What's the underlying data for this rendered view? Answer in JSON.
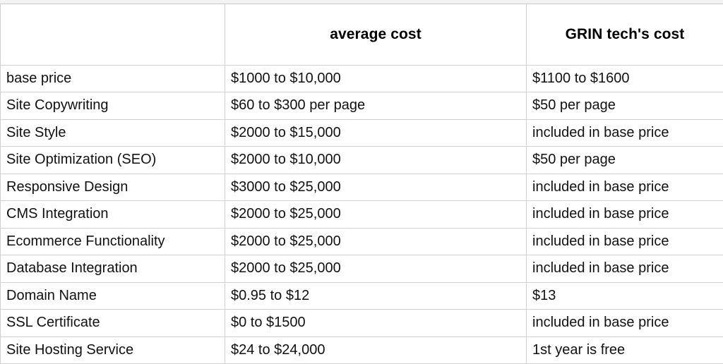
{
  "table": {
    "name": "website-cost-comparison-table",
    "columns": [
      {
        "key": "feature",
        "label": "",
        "align": "left"
      },
      {
        "key": "average",
        "label": "average cost",
        "align": "center"
      },
      {
        "key": "grin",
        "label": "GRIN tech's cost",
        "align": "center"
      }
    ],
    "rows": [
      {
        "feature": "base price",
        "average": "$1000 to $10,000",
        "grin": "$1100 to $1600"
      },
      {
        "feature": "Site Copywriting",
        "average": "$60 to $300 per page",
        "grin": "$50 per page"
      },
      {
        "feature": "Site Style",
        "average": "$2000 to $15,000",
        "grin": "included in base price"
      },
      {
        "feature": "Site Optimization (SEO)",
        "average": "$2000 to $10,000",
        "grin": "$50 per page"
      },
      {
        "feature": "Responsive Design",
        "average": "$3000 to $25,000",
        "grin": "included in base price"
      },
      {
        "feature": "CMS Integration",
        "average": "$2000 to $25,000",
        "grin": "included in base price"
      },
      {
        "feature": "Ecommerce Functionality",
        "average": "$2000 to $25,000",
        "grin": "included in base price"
      },
      {
        "feature": "Database Integration",
        "average": "$2000 to $25,000",
        "grin": "included in base price"
      },
      {
        "feature": "Domain Name",
        "average": "$0.95 to $12",
        "grin": "$13"
      },
      {
        "feature": "SSL Certificate",
        "average": "$0 to $1500",
        "grin": "included in base price"
      },
      {
        "feature": "Site Hosting Service",
        "average": "$24 to $24,000",
        "grin": "1st year is free"
      }
    ]
  },
  "colors": {
    "background": "#ffffff",
    "border": "#d0d0d0",
    "text": "#111111",
    "header_text": "#000000",
    "top_strip": "#f3f3f3"
  }
}
